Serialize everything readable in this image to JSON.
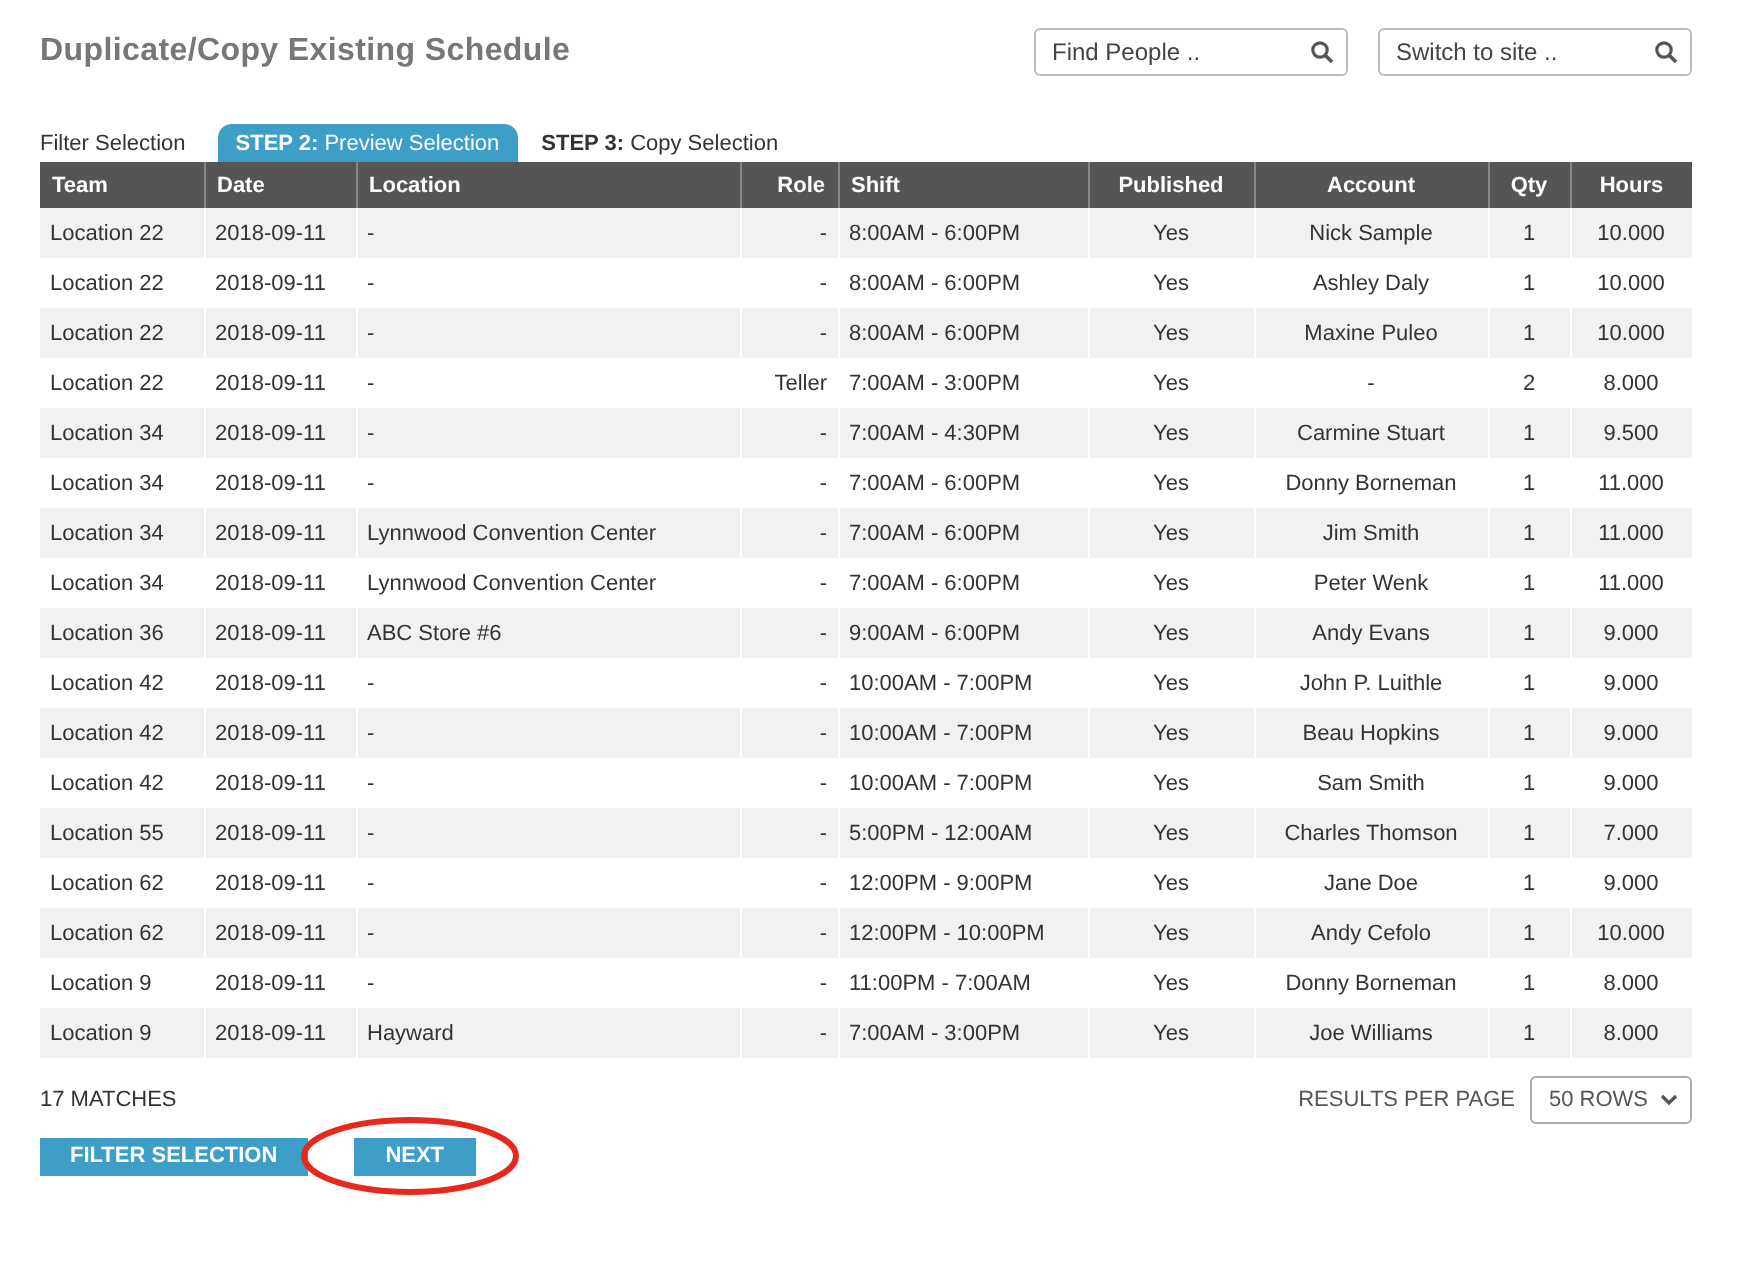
{
  "page": {
    "title": "Duplicate/Copy Existing Schedule"
  },
  "search_fields": [
    {
      "placeholder": "Find People .."
    },
    {
      "placeholder": "Switch to site .."
    }
  ],
  "tabs": [
    {
      "label": "Filter Selection",
      "selected": false
    },
    {
      "label": "**STEP 2:** Preview Selection",
      "selected": true
    },
    {
      "label": "**STEP 3:** Copy Selection",
      "selected": false
    }
  ],
  "table": {
    "columns": [
      "Team",
      "Date",
      "Location",
      "Role",
      "Shift",
      "Published",
      "Account",
      "Qty",
      "Hours"
    ],
    "rows": [
      [
        "Location 22",
        "2018-09-11",
        "-",
        "-",
        "8:00AM - 6:00PM",
        "Yes",
        "Nick Sample",
        "1",
        "10.000"
      ],
      [
        "Location 22",
        "2018-09-11",
        "-",
        "-",
        "8:00AM - 6:00PM",
        "Yes",
        "Ashley Daly",
        "1",
        "10.000"
      ],
      [
        "Location 22",
        "2018-09-11",
        "-",
        "-",
        "8:00AM - 6:00PM",
        "Yes",
        "Maxine Puleo",
        "1",
        "10.000"
      ],
      [
        "Location 22",
        "2018-09-11",
        "-",
        "Teller",
        "7:00AM - 3:00PM",
        "Yes",
        "-",
        "2",
        "8.000"
      ],
      [
        "Location 34",
        "2018-09-11",
        "-",
        "-",
        "7:00AM - 4:30PM",
        "Yes",
        "Carmine Stuart",
        "1",
        "9.500"
      ],
      [
        "Location 34",
        "2018-09-11",
        "-",
        "-",
        "7:00AM - 6:00PM",
        "Yes",
        "Donny Borneman",
        "1",
        "11.000"
      ],
      [
        "Location 34",
        "2018-09-11",
        "Lynnwood Convention Center",
        "-",
        "7:00AM - 6:00PM",
        "Yes",
        "Jim Smith",
        "1",
        "11.000"
      ],
      [
        "Location 34",
        "2018-09-11",
        "Lynnwood Convention Center",
        "-",
        "7:00AM - 6:00PM",
        "Yes",
        "Peter Wenk",
        "1",
        "11.000"
      ],
      [
        "Location 36",
        "2018-09-11",
        "ABC Store #6",
        "-",
        "9:00AM - 6:00PM",
        "Yes",
        "Andy Evans",
        "1",
        "9.000"
      ],
      [
        "Location 42",
        "2018-09-11",
        "-",
        "-",
        "10:00AM - 7:00PM",
        "Yes",
        "John P. Luithle",
        "1",
        "9.000"
      ],
      [
        "Location 42",
        "2018-09-11",
        "-",
        "-",
        "10:00AM - 7:00PM",
        "Yes",
        "Beau Hopkins",
        "1",
        "9.000"
      ],
      [
        "Location 42",
        "2018-09-11",
        "-",
        "-",
        "10:00AM - 7:00PM",
        "Yes",
        "Sam Smith",
        "1",
        "9.000"
      ],
      [
        "Location 55",
        "2018-09-11",
        "-",
        "-",
        "5:00PM - 12:00AM",
        "Yes",
        "Charles Thomson",
        "1",
        "7.000"
      ],
      [
        "Location 62",
        "2018-09-11",
        "-",
        "-",
        "12:00PM - 9:00PM",
        "Yes",
        "Jane Doe",
        "1",
        "9.000"
      ],
      [
        "Location 62",
        "2018-09-11",
        "-",
        "-",
        "12:00PM - 10:00PM",
        "Yes",
        "Andy Cefolo",
        "1",
        "10.000"
      ],
      [
        "Location 9",
        "2018-09-11",
        "-",
        "-",
        "11:00PM - 7:00AM",
        "Yes",
        "Donny Borneman",
        "1",
        "8.000"
      ],
      [
        "Location 9",
        "2018-09-11",
        "Hayward",
        "-",
        "7:00AM - 3:00PM",
        "Yes",
        "Joe Williams",
        "1",
        "8.000"
      ]
    ]
  },
  "footer": {
    "matches": "17 MATCHES",
    "per_page_label": "RESULTS PER PAGE",
    "per_page_value": "50 ROWS"
  },
  "buttons": [
    {
      "label": "FILTER SELECTION",
      "highlighted": false
    },
    {
      "label": "NEXT",
      "highlighted": true
    }
  ]
}
